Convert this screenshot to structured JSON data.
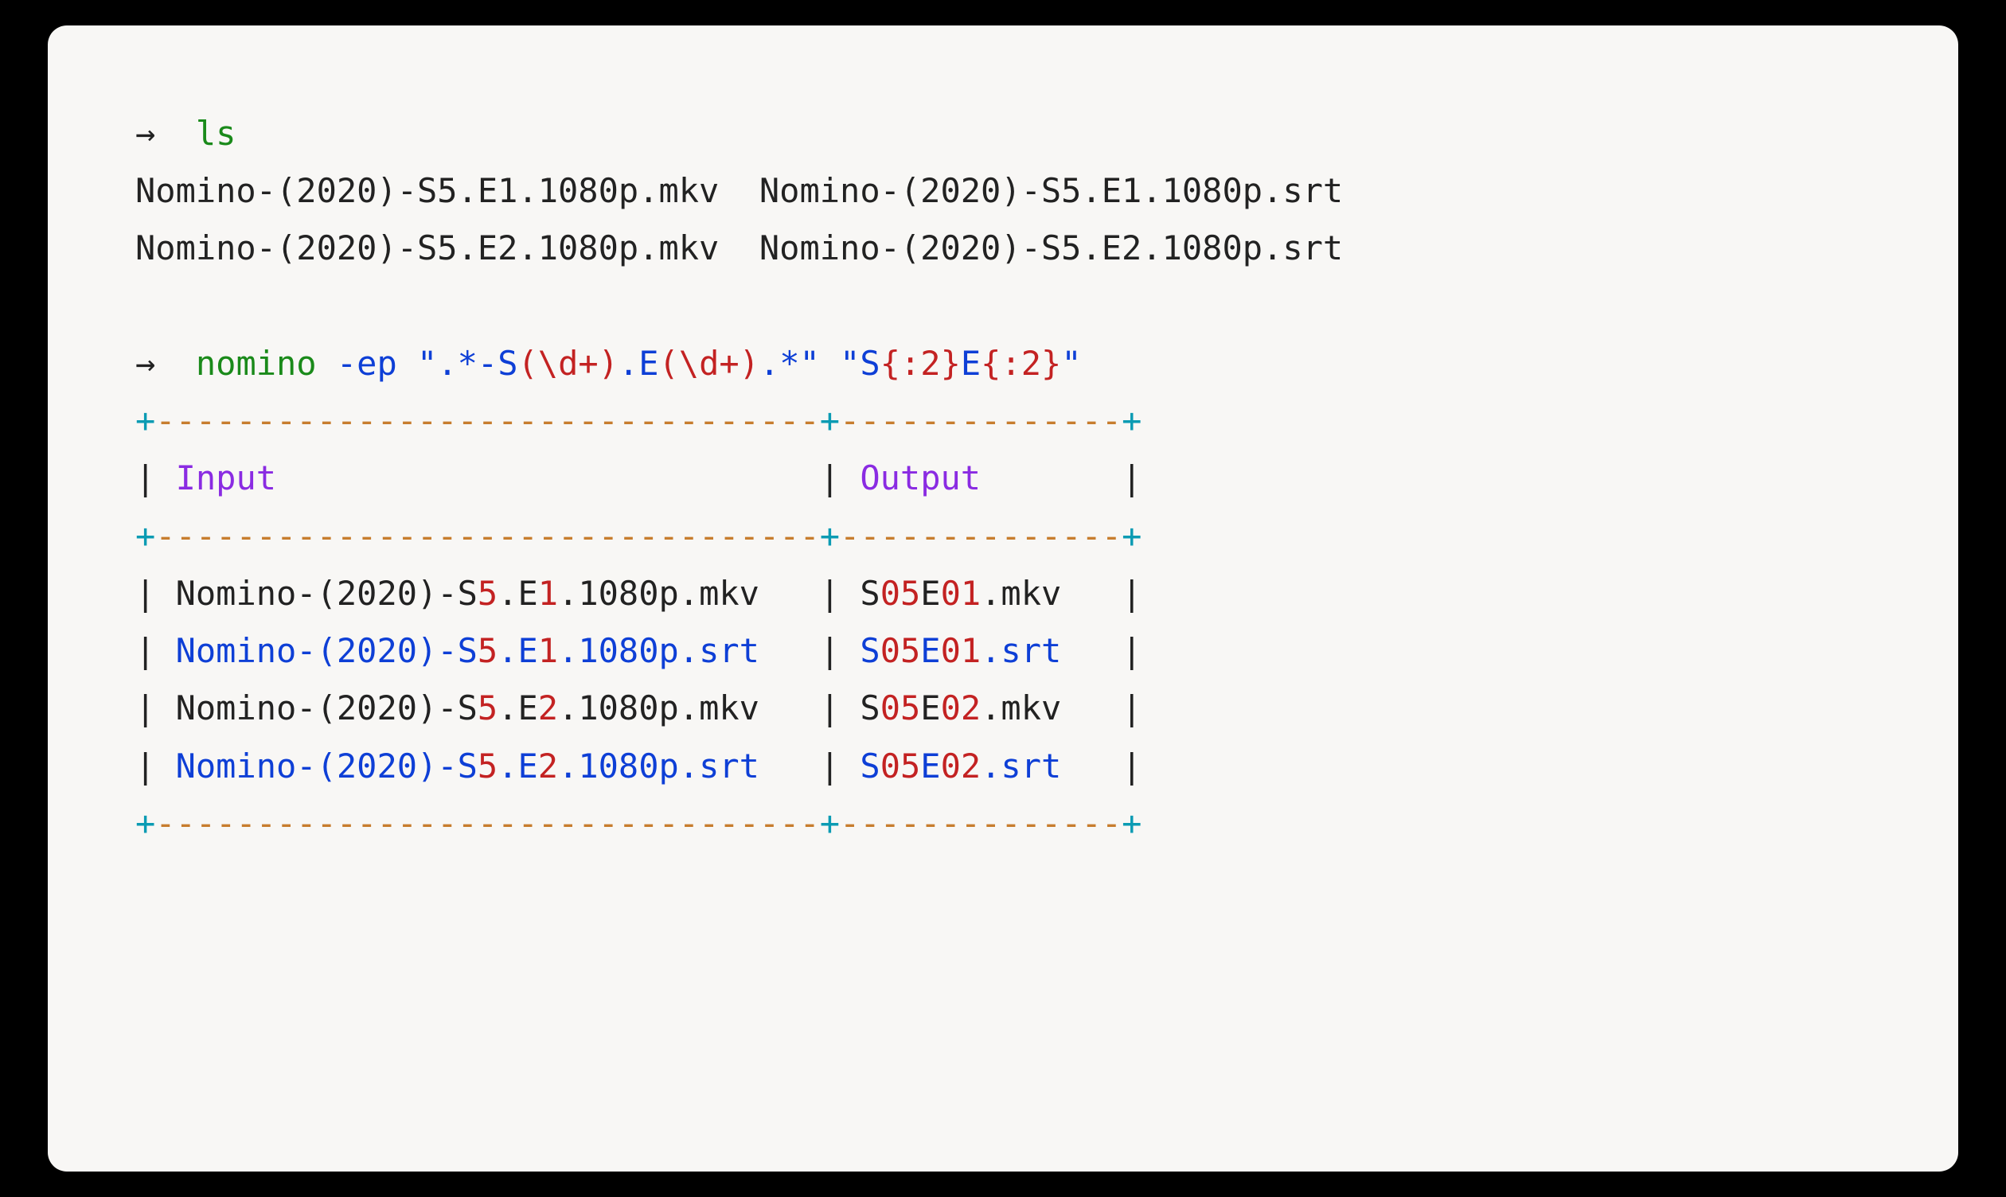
{
  "prompt": "→",
  "ls": {
    "cmd": "ls",
    "row1_a": "Nomino-(2020)-S5.E1.1080p.mkv",
    "row1_b": "Nomino-(2020)-S5.E1.1080p.srt",
    "row2_a": "Nomino-(2020)-S5.E2.1080p.mkv",
    "row2_b": "Nomino-(2020)-S5.E2.1080p.srt"
  },
  "nomino": {
    "cmd": "nomino",
    "flag": "-ep",
    "q1": "\"",
    "pat_a": ".*-S",
    "pat_grp": "(\\d+)",
    "pat_b": ".E",
    "pat_c": ".*",
    "q2": "\"",
    "fmt_a": "S",
    "fmt_brace": "{:2}",
    "fmt_b": "E",
    "header_input": "Input",
    "header_output": "Output",
    "border_plus": "+",
    "border_dash33": "---------------------------------",
    "border_dash14": "--------------",
    "pipe": "|",
    "rows": [
      {
        "in_a": "Nomino-(2020)-S",
        "in_s": "5",
        "in_b": ".E",
        "in_e": "1",
        "in_c": ".1080p.mkv",
        "out_a": "S",
        "out_s": "05",
        "out_b": "E",
        "out_e": "01",
        "out_c": ".mkv",
        "srt": false
      },
      {
        "in_a": "Nomino-(2020)-S",
        "in_s": "5",
        "in_b": ".E",
        "in_e": "1",
        "in_c": ".1080p.srt",
        "out_a": "S",
        "out_s": "05",
        "out_b": "E",
        "out_e": "01",
        "out_c": ".srt",
        "srt": true
      },
      {
        "in_a": "Nomino-(2020)-S",
        "in_s": "5",
        "in_b": ".E",
        "in_e": "2",
        "in_c": ".1080p.mkv",
        "out_a": "S",
        "out_s": "05",
        "out_b": "E",
        "out_e": "02",
        "out_c": ".mkv",
        "srt": false
      },
      {
        "in_a": "Nomino-(2020)-S",
        "in_s": "5",
        "in_b": ".E",
        "in_e": "2",
        "in_c": ".1080p.srt",
        "out_a": "S",
        "out_s": "05",
        "out_b": "E",
        "out_e": "02",
        "out_c": ".srt",
        "srt": true
      }
    ]
  }
}
